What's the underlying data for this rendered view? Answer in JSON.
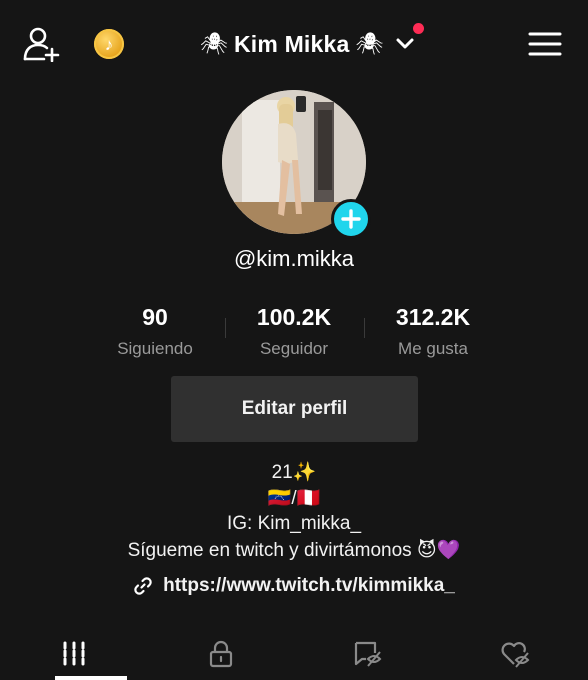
{
  "header": {
    "title": "Kim Mikka",
    "title_decoration_left": "🕷",
    "title_decoration_right": "🕷",
    "add_user_icon": "person-add-icon",
    "coin_icon": "tiktok-coin-icon",
    "coin_glyph": "♪",
    "dropdown_icon": "chevron-down-icon",
    "menu_icon": "hamburger-menu-icon",
    "notification_color": "#fe2c55"
  },
  "profile": {
    "username": "@kim.mikka",
    "avatar_badge_color": "#20d5ec"
  },
  "stats": [
    {
      "value": "90",
      "label": "Siguiendo"
    },
    {
      "value": "100.2K",
      "label": "Seguidor"
    },
    {
      "value": "312.2K",
      "label": "Me gusta"
    }
  ],
  "edit_button": {
    "label": "Editar perfil"
  },
  "bio": {
    "line1": "21✨",
    "line2": "🇻🇪/🇵🇪",
    "line3": "IG: Kim_mikka_",
    "line4": "Sígueme en twitch y divirtámonos 😈💜"
  },
  "link": {
    "icon": "link-icon",
    "url": "https://www.twitch.tv/kimmikka_"
  },
  "tabs": [
    {
      "icon": "videos-grid-icon",
      "active": true
    },
    {
      "icon": "lock-icon",
      "active": false
    },
    {
      "icon": "repost-hidden-icon",
      "active": false
    },
    {
      "icon": "liked-hidden-icon",
      "active": false
    }
  ]
}
